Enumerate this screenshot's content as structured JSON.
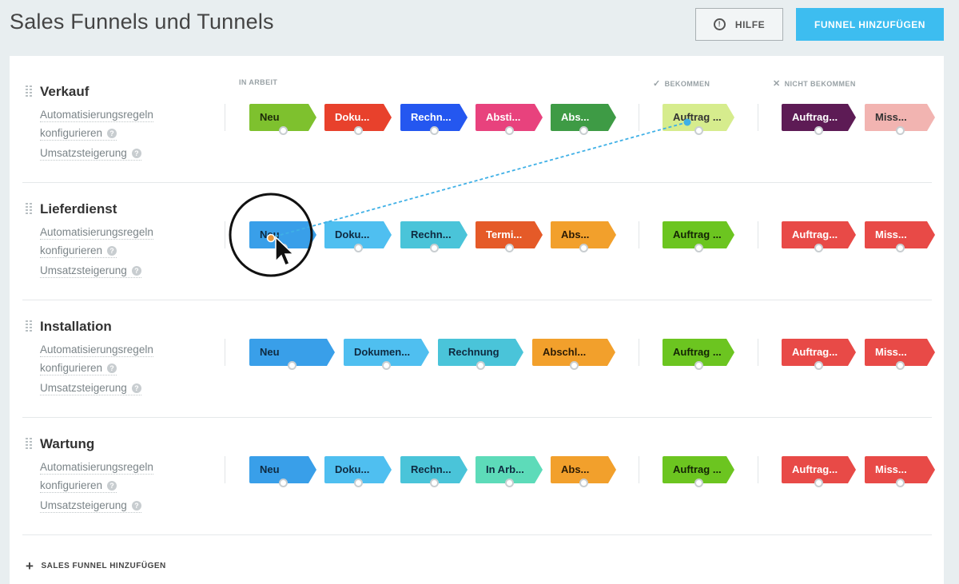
{
  "header": {
    "title": "Sales Funnels und Tunnels",
    "help_label": "HILFE",
    "help_icon": "!",
    "add_funnel_label": "FUNNEL HINZUFÜGEN"
  },
  "columns": {
    "in_progress": "IN ARBEIT",
    "won": "BEKOMMEN",
    "won_icon": "✓",
    "lost": "NICHT BEKOMMEN",
    "lost_icon": "✕"
  },
  "common": {
    "automation_label": "Automatisierungsregeln",
    "configure_label": "konfigurieren",
    "upsell_label": "Umsatzsteigerung",
    "help_glyph": "?"
  },
  "funnels": [
    {
      "name": "Verkauf",
      "stages": [
        {
          "label": "Neu",
          "color": "#7ec12e",
          "text_color": "#1d2a0a"
        },
        {
          "label": "Doku...",
          "color": "#e8412c",
          "text_color": "#ffffff"
        },
        {
          "label": "Rechn...",
          "color": "#2457f0",
          "text_color": "#ffffff"
        },
        {
          "label": "Absti...",
          "color": "#e8427d",
          "text_color": "#ffffff"
        },
        {
          "label": "Abs...",
          "color": "#3e9b45",
          "text_color": "#ffffff"
        }
      ],
      "won": {
        "label": "Auftrag ...",
        "color": "#d6ec8d",
        "text_color": "#333333"
      },
      "lost": [
        {
          "label": "Auftrag...",
          "color": "#5d1b55",
          "text_color": "#ffffff"
        },
        {
          "label": "Miss...",
          "color": "#f2b4b1",
          "text_color": "#333333"
        }
      ]
    },
    {
      "name": "Lieferdienst",
      "stages": [
        {
          "label": "Neu",
          "color": "#399fe9",
          "text_color": "#0f2a40"
        },
        {
          "label": "Doku...",
          "color": "#4fbff0",
          "text_color": "#0f2a40"
        },
        {
          "label": "Rechn...",
          "color": "#4ac4d9",
          "text_color": "#0f2a40"
        },
        {
          "label": "Termi...",
          "color": "#e55a28",
          "text_color": "#ffffff"
        },
        {
          "label": "Abs...",
          "color": "#f2a02c",
          "text_color": "#2b1b05"
        }
      ],
      "won": {
        "label": "Auftrag ...",
        "color": "#6cc520",
        "text_color": "#142405"
      },
      "lost": [
        {
          "label": "Auftrag...",
          "color": "#e84a47",
          "text_color": "#ffffff"
        },
        {
          "label": "Miss...",
          "color": "#e84a47",
          "text_color": "#ffffff"
        }
      ]
    },
    {
      "name": "Installation",
      "stages": [
        {
          "label": "Neu",
          "color": "#399fe9",
          "text_color": "#0f2a40"
        },
        {
          "label": "Dokumen...",
          "color": "#4fbff0",
          "text_color": "#0f2a40"
        },
        {
          "label": "Rechnung",
          "color": "#4ac4d9",
          "text_color": "#0f2a40"
        },
        {
          "label": "Abschl...",
          "color": "#f2a02c",
          "text_color": "#2b1b05"
        }
      ],
      "won": {
        "label": "Auftrag ...",
        "color": "#6cc520",
        "text_color": "#142405"
      },
      "lost": [
        {
          "label": "Auftrag...",
          "color": "#e84a47",
          "text_color": "#ffffff"
        },
        {
          "label": "Miss...",
          "color": "#e84a47",
          "text_color": "#ffffff"
        }
      ]
    },
    {
      "name": "Wartung",
      "stages": [
        {
          "label": "Neu",
          "color": "#399fe9",
          "text_color": "#0f2a40"
        },
        {
          "label": "Doku...",
          "color": "#4fbff0",
          "text_color": "#0f2a40"
        },
        {
          "label": "Rechn...",
          "color": "#4ac4d9",
          "text_color": "#0f2a40"
        },
        {
          "label": "In Arb...",
          "color": "#5ddbb9",
          "text_color": "#0f2a40"
        },
        {
          "label": "Abs...",
          "color": "#f2a02c",
          "text_color": "#2b1b05"
        }
      ],
      "won": {
        "label": "Auftrag ...",
        "color": "#6cc520",
        "text_color": "#142405"
      },
      "lost": [
        {
          "label": "Auftrag...",
          "color": "#e84a47",
          "text_color": "#ffffff"
        },
        {
          "label": "Miss...",
          "color": "#e84a47",
          "text_color": "#ffffff"
        }
      ]
    }
  ],
  "footer": {
    "add_sales_funnel_label": "SALES FUNNEL HINZUFÜGEN",
    "plus_icon": "+"
  },
  "colors": {
    "accent": "#3dbdf0",
    "connector_line": "#3fb0e6",
    "drag_dot": "#e8963c"
  }
}
